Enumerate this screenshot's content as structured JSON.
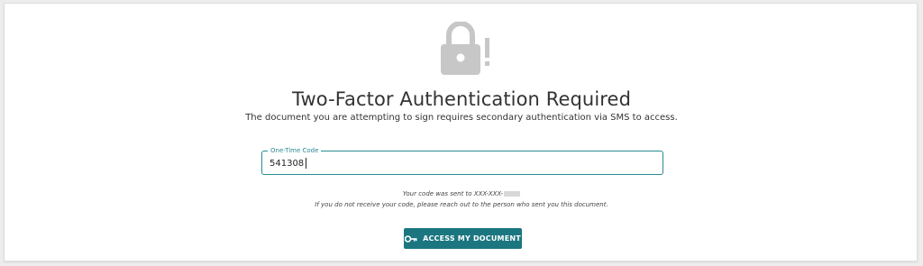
{
  "header": {
    "icon": "lock-alert-icon",
    "title": "Two-Factor Authentication Required",
    "subtitle": "The document you are attempting to sign requires secondary authentication via SMS to access."
  },
  "form": {
    "label": "One-Time Code",
    "value": "541308"
  },
  "notes": {
    "sent_prefix": "Your code was sent to XXX-XXX-",
    "help": "If you do not receive your code, please reach out to the person who sent you this document."
  },
  "actions": {
    "submit_label": "ACCESS MY DOCUMENT",
    "submit_icon": "key-icon"
  },
  "colors": {
    "accent": "#1b7680",
    "field_border": "#2a8a92",
    "icon_gray": "#c7c7c7"
  }
}
